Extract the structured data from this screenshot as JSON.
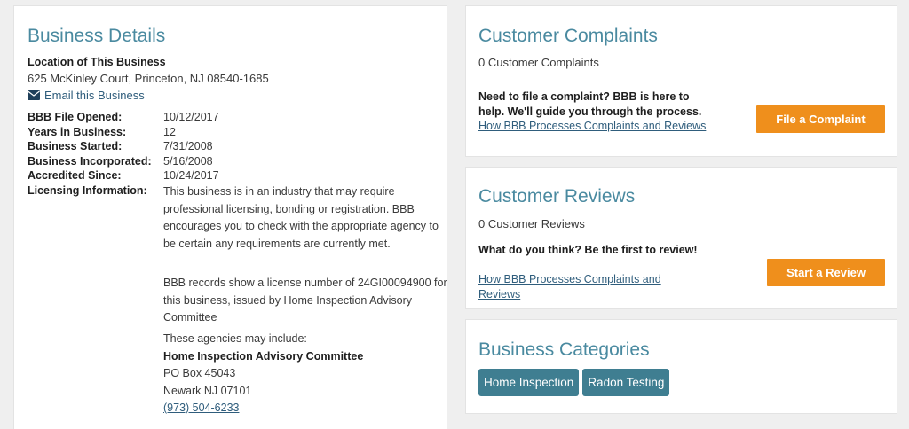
{
  "business_details": {
    "title": "Business Details",
    "location_label": "Location of This Business",
    "address": "625 McKinley Court, Princeton, NJ 08540-1685",
    "email_link": "Email this Business",
    "rows": [
      {
        "label": "BBB File Opened:",
        "value": "10/12/2017"
      },
      {
        "label": "Years in Business:",
        "value": "12"
      },
      {
        "label": "Business Started:",
        "value": "7/31/2008"
      },
      {
        "label": "Business Incorporated:",
        "value": "5/16/2008"
      },
      {
        "label": "Accredited Since:",
        "value": "10/24/2017"
      },
      {
        "label": "Licensing Information:",
        "value": ""
      }
    ],
    "licensing_para1": "This business is in an industry that may require professional licensing, bonding or registration. BBB encourages you to check with the appropriate agency to be certain any requirements are currently met.",
    "licensing_para2": "BBB records show a license number of 24GI00094900 for this business, issued by Home Inspection Advisory Committee",
    "agencies_intro": "These agencies may include:",
    "agency_name": "Home Inspection Advisory Committee",
    "agency_po": "PO Box 45043",
    "agency_city": "Newark NJ 07101",
    "agency_phone": "(973) 504-6233"
  },
  "complaints": {
    "title": "Customer Complaints",
    "count": "0 Customer Complaints",
    "prompt": "Need to file a complaint? BBB is here to help. We'll guide you through the process.",
    "link": "How BBB Processes Complaints and Reviews",
    "button": "File a Complaint"
  },
  "reviews": {
    "title": "Customer Reviews",
    "count": "0 Customer Reviews",
    "prompt": "What do you think? Be the first to review!",
    "link": "How BBB Processes Complaints and Reviews",
    "button": "Start a Review"
  },
  "categories": {
    "title": "Business Categories",
    "items": [
      "Home Inspection",
      "Radon Testing"
    ]
  },
  "colors": {
    "accent_title": "#4a8aa0",
    "button_orange": "#ef8f1c",
    "tag_teal": "#3f7e91",
    "link": "#2f5d7c"
  },
  "icons": {
    "email": "envelope-icon"
  }
}
